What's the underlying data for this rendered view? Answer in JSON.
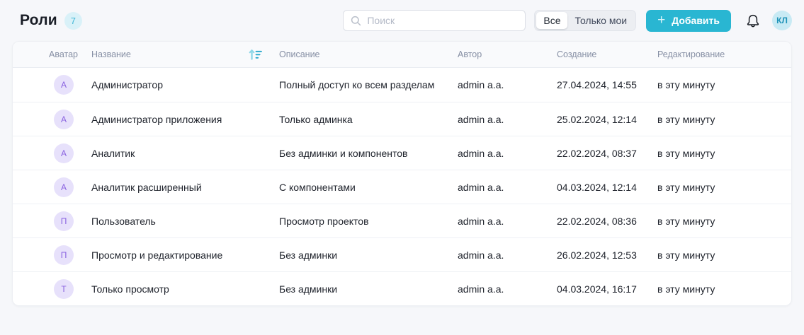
{
  "header": {
    "title": "Роли",
    "count": "7",
    "search_placeholder": "Поиск",
    "filter": {
      "all_label": "Все",
      "mine_label": "Только мои",
      "selected": "Все"
    },
    "add_button_label": "Добавить",
    "add_button_plus": "+",
    "user_initials": "КЛ"
  },
  "icons": {
    "search": "magnifier",
    "sort": "sort-ascending",
    "bell": "notifications"
  },
  "colors": {
    "accent": "#29b6d2",
    "badge_bg": "#d9f1f8",
    "badge_text": "#3fb6d6",
    "row_avatar_bg": "#e7e1fb",
    "row_avatar_text": "#8a63e0",
    "user_avatar_bg": "#c8eaf4",
    "user_avatar_text": "#1f93b8",
    "page_bg": "#f6f7fa"
  },
  "table": {
    "columns": [
      "Аватар",
      "Название",
      "Описание",
      "Автор",
      "Создание",
      "Редактирование"
    ],
    "rows": [
      {
        "avatar": "А",
        "name": "Администратор",
        "description": "Полный доступ ко всем разделам",
        "author": "admin a.a.",
        "created": "27.04.2024, 14:55",
        "edited": "в эту минуту"
      },
      {
        "avatar": "А",
        "name": "Администратор приложения",
        "description": "Только админка",
        "author": "admin a.a.",
        "created": "25.02.2024, 12:14",
        "edited": "в эту минуту"
      },
      {
        "avatar": "А",
        "name": "Аналитик",
        "description": "Без админки и компонентов",
        "author": "admin a.a.",
        "created": "22.02.2024, 08:37",
        "edited": "в эту минуту"
      },
      {
        "avatar": "А",
        "name": "Аналитик расширенный",
        "description": "С компонентами",
        "author": "admin a.a.",
        "created": "04.03.2024, 12:14",
        "edited": "в эту минуту"
      },
      {
        "avatar": "П",
        "name": "Пользователь",
        "description": "Просмотр проектов",
        "author": "admin a.a.",
        "created": "22.02.2024, 08:36",
        "edited": "в эту минуту"
      },
      {
        "avatar": "П",
        "name": "Просмотр и редактирование",
        "description": "Без админки",
        "author": "admin a.a.",
        "created": "26.02.2024, 12:53",
        "edited": "в эту минуту"
      },
      {
        "avatar": "Т",
        "name": "Только просмотр",
        "description": "Без админки",
        "author": "admin a.a.",
        "created": "04.03.2024, 16:17",
        "edited": "в эту минуту"
      }
    ]
  }
}
